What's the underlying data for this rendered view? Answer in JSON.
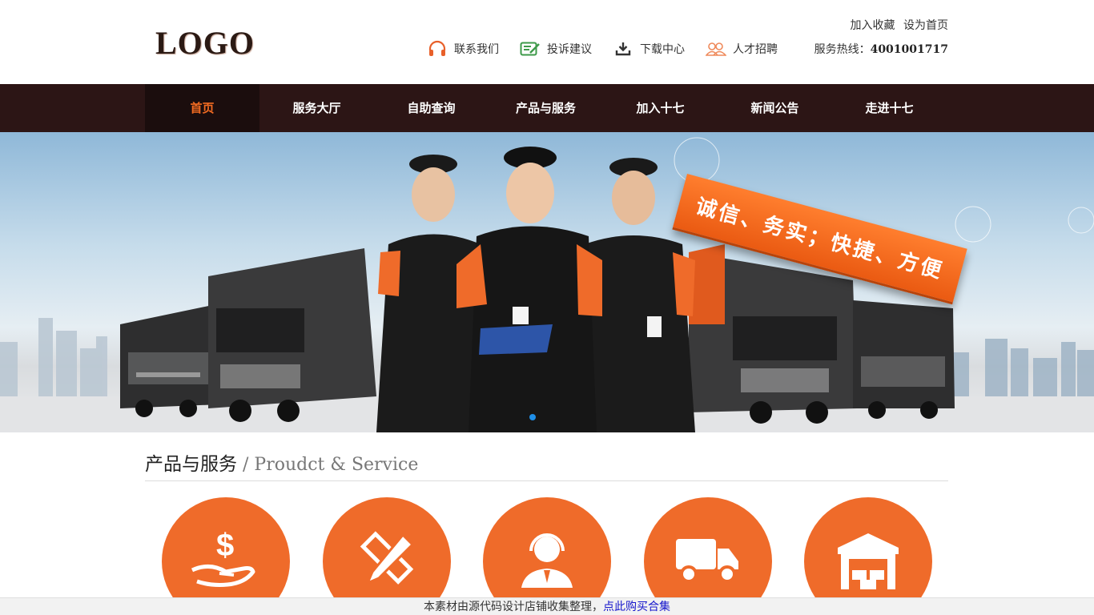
{
  "header": {
    "logo": "LOGO",
    "top_links": [
      {
        "label": "联系我们",
        "icon": "headset-icon"
      },
      {
        "label": "投诉建议",
        "icon": "edit-note-icon"
      },
      {
        "label": "下载中心",
        "icon": "download-icon"
      },
      {
        "label": "人才招聘",
        "icon": "people-icon"
      }
    ],
    "favorite": "加入收藏",
    "homepage": "设为首页",
    "hotline_label": "服务热线：",
    "hotline_number": "4001001717"
  },
  "nav": {
    "items": [
      "首页",
      "服务大厅",
      "自助查询",
      "产品与服务",
      "加入十七",
      "新闻公告",
      "走进十七"
    ],
    "active": "首页"
  },
  "banner": {
    "slogan": "诚信、务实；快捷、方便"
  },
  "section": {
    "title_cn": "产品与服务",
    "title_en": " / Proudct & Service",
    "services": [
      {
        "icon": "money-hand-icon"
      },
      {
        "icon": "pencil-ruler-icon"
      },
      {
        "icon": "customer-service-icon"
      },
      {
        "icon": "truck-icon"
      },
      {
        "icon": "warehouse-icon"
      }
    ]
  },
  "footer_bar": {
    "text": "本素材由源代码设计店铺收集整理，",
    "link": "点此购买合集"
  },
  "colors": {
    "nav_bg": "#2c1515",
    "accent": "#ef6b2a",
    "link": "#1515cc"
  }
}
